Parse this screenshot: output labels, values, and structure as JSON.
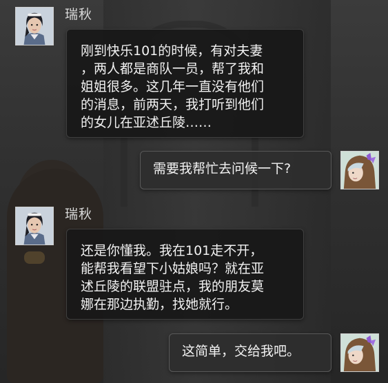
{
  "speaker_name": "瑞秋",
  "messages": [
    {
      "from": "npc",
      "text": "刚到快乐101的时候，有对夫妻\n，两人都是商队一员，帮了我和\n姐姐很多。这几年一直没有他们\n的消息，前两天，我打听到他们\n的女儿在亚述丘陵……"
    },
    {
      "from": "player",
      "text": "需要我帮忙去问候一下?"
    },
    {
      "from": "npc",
      "text": "还是你懂我。我在101走不开，\n能帮我看望下小姑娘吗？就在亚\n述丘陵的联盟驻点，我的朋友莫\n娜在那边执勤，找她就行。"
    },
    {
      "from": "player",
      "text": "这简单，交给我吧。"
    }
  ]
}
